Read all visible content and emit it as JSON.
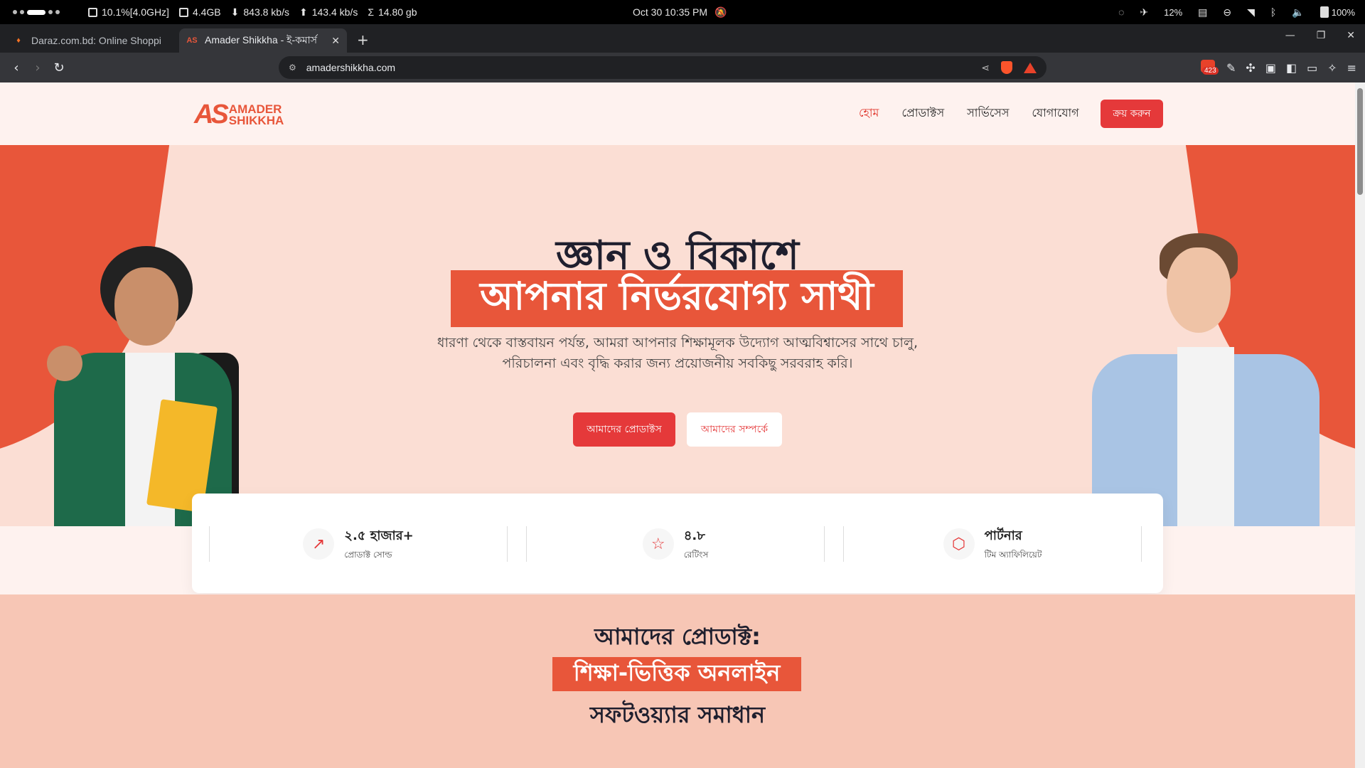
{
  "system_bar": {
    "cpu": "10.1%[4.0GHz]",
    "ram": "4.4GB",
    "download": "843.8 kb/s",
    "upload": "143.4 kb/s",
    "total": "14.80 gb",
    "datetime": "Oct 30  10:35 PM",
    "brightness": "12%",
    "battery": "100%"
  },
  "tabs": [
    {
      "title": "Daraz.com.bd: Online Shoppi",
      "active": false
    },
    {
      "title": "Amader Shikkha - ই-কমার্স",
      "active": true
    }
  ],
  "toolbar": {
    "url": "amadershikkha.com",
    "extension_badge": "423"
  },
  "site": {
    "logo_mark": "AS",
    "logo_line1": "AMADER",
    "logo_line2": "SHIKKHA",
    "nav": [
      "হোম",
      "প্রোডাক্টস",
      "সার্ভিসেস",
      "যোগাযোগ"
    ],
    "buy_button": "ক্রয় করুন"
  },
  "hero": {
    "title_line1": "জ্ঞান ও বিকাশে",
    "title_line2": "আপনার নির্ভরযোগ্য সাথী",
    "description": "ধারণা থেকে বাস্তবায়ন পর্যন্ত, আমরা আপনার শিক্ষামূলক উদ্যোগ আত্মবিশ্বাসের সাথে চালু, পরিচালনা এবং বৃদ্ধি করার জন্য প্রয়োজনীয় সবকিছু সরবরাহ করি।",
    "primary_button": "আমাদের প্রোডাক্টস",
    "secondary_button": "আমাদের সম্পর্কে"
  },
  "stats": [
    {
      "icon": "trending-up-icon",
      "value": "২.৫ হাজার+",
      "label": "প্রোডাক্ট সোল্ড"
    },
    {
      "icon": "star-icon",
      "value": "৪.৮",
      "label": "রেটিংস"
    },
    {
      "icon": "package-icon",
      "value": "পার্টনার",
      "label": "টিম অ্যাফিলিয়েট"
    }
  ],
  "products_section": {
    "line1": "আমাদের প্রোডাক্ট:",
    "line2": "শিক্ষা-ভিত্তিক অনলাইন",
    "line3": "সফটওয়্যার সমাধান"
  },
  "colors": {
    "brand": "#e8563a",
    "button": "#e5393a",
    "hero_bg": "#fbded4",
    "products_bg": "#f7c6b5"
  }
}
